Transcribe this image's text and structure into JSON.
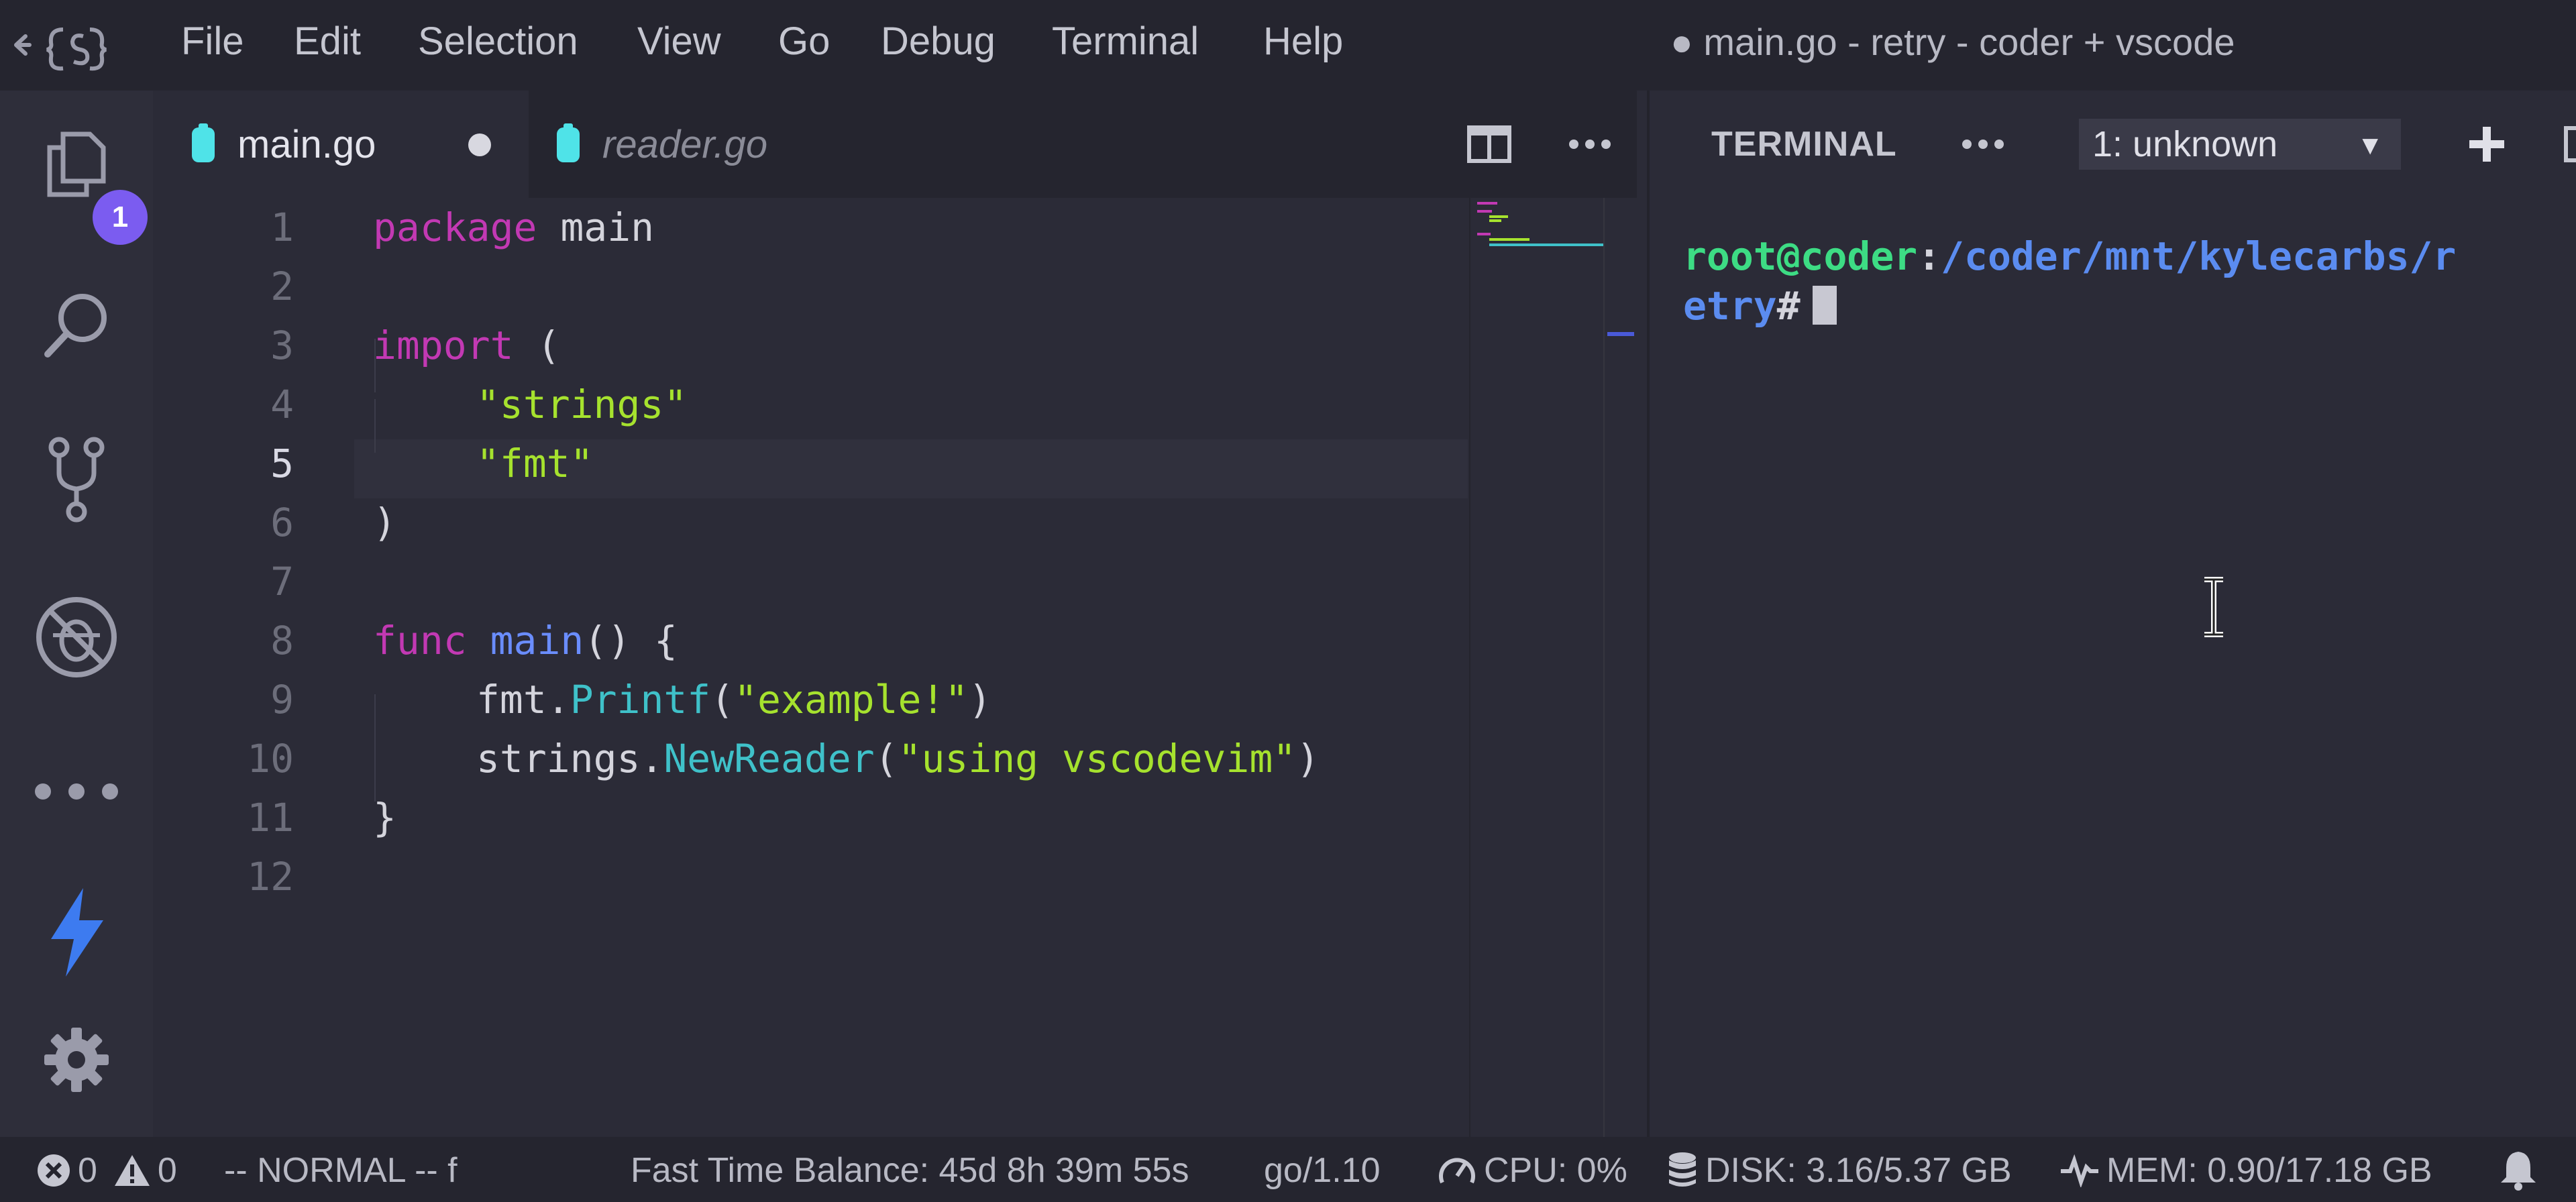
{
  "menu": {
    "items": [
      "File",
      "Edit",
      "Selection",
      "View",
      "Go",
      "Debug",
      "Terminal",
      "Help"
    ]
  },
  "window": {
    "title": "● main.go - retry - coder + vscode"
  },
  "activity_bar": {
    "explorer_badge": "1",
    "icons": [
      "files-icon",
      "search-icon",
      "source-control-icon",
      "debug-icon",
      "more-icon",
      "lightning-icon",
      "gear-icon"
    ]
  },
  "tabs": [
    {
      "label": "main.go",
      "dirty": true,
      "active": true
    },
    {
      "label": "reader.go",
      "dirty": false,
      "active": false
    }
  ],
  "editor": {
    "current_line": 5,
    "line_numbers": [
      "1",
      "2",
      "3",
      "4",
      "5",
      "6",
      "7",
      "8",
      "9",
      "10",
      "11",
      "12"
    ],
    "code": {
      "l1_kw": "package",
      "l1_rest": " main",
      "l3_kw": "import",
      "l3_rest": " (",
      "l4_str": "\"strings\"",
      "l5_str": "\"fmt\"",
      "l6": ")",
      "l8_kw": "func",
      "l8_fn": "main",
      "l8_rest": "() {",
      "l9_obj": "fmt.",
      "l9_method": "Printf",
      "l9_open": "(",
      "l9_str": "\"example!\"",
      "l9_close": ")",
      "l10_obj": "strings.",
      "l10_method": "NewReader",
      "l10_open": "(",
      "l10_str": "\"using vscodevim\"",
      "l10_close": ")",
      "l11": "}"
    }
  },
  "terminal": {
    "title": "TERMINAL",
    "selected_instance": "1: unknown",
    "prompt_user": "root@coder",
    "prompt_sep": ":",
    "prompt_path_1": "/coder/mnt/kylecarbs/r",
    "prompt_path_2": "etry",
    "prompt_symbol": "#"
  },
  "status_bar": {
    "errors": "0",
    "warnings": "0",
    "vim_mode": "-- NORMAL -- f",
    "time_balance": "Fast Time Balance: 45d 8h 39m 55s",
    "go_version": "go/1.10",
    "cpu": "CPU: 0%",
    "disk": "DISK: 3.16/5.37 GB",
    "mem": "MEM: 0.90/17.18 GB"
  },
  "colors": {
    "background": "#2b2b37",
    "keyword": "#c239b3",
    "function": "#6a8dff",
    "string": "#a6e22e",
    "method": "#3fc1c9",
    "terminal_user": "#3ddc84",
    "terminal_path": "#5b8cf0",
    "badge": "#7b5cf0",
    "lightning": "#3d7bf0"
  }
}
